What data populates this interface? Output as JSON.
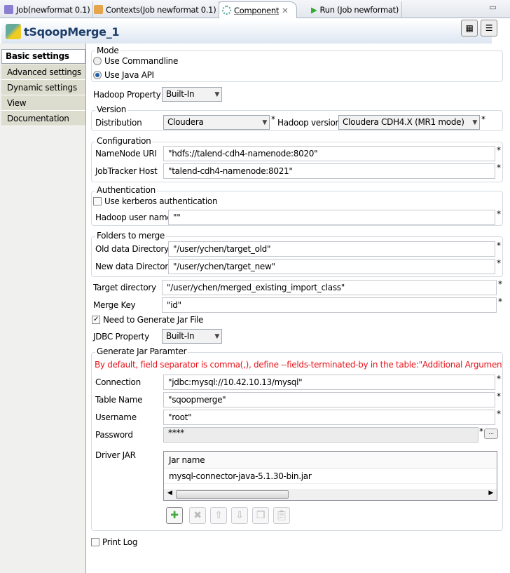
{
  "tabs": [
    {
      "label": "Job(newformat 0.1)",
      "icon": "job-icon"
    },
    {
      "label": "Contexts(Job newformat 0.1)",
      "icon": "contexts-icon"
    },
    {
      "label": "Component",
      "icon": "component-icon",
      "active": true
    },
    {
      "label": "Run (Job newformat)",
      "icon": "run-icon"
    }
  ],
  "header": {
    "title": "tSqoopMerge_1"
  },
  "sidebar": {
    "items": [
      {
        "label": "Basic settings",
        "selected": true
      },
      {
        "label": "Advanced settings"
      },
      {
        "label": "Dynamic settings"
      },
      {
        "label": "View"
      },
      {
        "label": "Documentation"
      }
    ]
  },
  "mode": {
    "legend": "Mode",
    "option1": "Use Commandline",
    "option2": "Use Java API",
    "selected": "Use Java API"
  },
  "hadoop_property": {
    "label": "Hadoop Property",
    "value": "Built-In"
  },
  "version": {
    "legend": "Version",
    "distribution_label": "Distribution",
    "distribution": "Cloudera",
    "hadoop_version_label": "Hadoop version",
    "hadoop_version": "Cloudera CDH4.X (MR1 mode)"
  },
  "configuration": {
    "legend": "Configuration",
    "namenode_label": "NameNode URI",
    "namenode": "\"hdfs://talend-cdh4-namenode:8020\"",
    "jobtracker_label": "JobTracker Host",
    "jobtracker": "\"talend-cdh4-namenode:8021\""
  },
  "authentication": {
    "legend": "Authentication",
    "kerberos_label": "Use kerberos authentication",
    "kerberos": false,
    "user_label": "Hadoop user name",
    "user": "\"\""
  },
  "folders": {
    "legend": "Folders to merge",
    "old_label": "Old data Directory",
    "old": "\"/user/ychen/target_old\"",
    "new_label": "New data Directory",
    "new": "\"/user/ychen/target_new\""
  },
  "target": {
    "label": "Target directory",
    "value": "\"/user/ychen/merged_existing_import_class\""
  },
  "merge_key": {
    "label": "Merge Key",
    "value": "\"id\""
  },
  "need_jar": {
    "label": "Need to Generate Jar File",
    "checked": true
  },
  "jdbc_property": {
    "label": "JDBC Property",
    "value": "Built-In"
  },
  "jar": {
    "legend": "Generate Jar Paramter",
    "warning": "By default, field separator is comma(,), define --fields-terminated-by in the table:\"Additional Arguments\" to  s",
    "connection_label": "Connection",
    "connection": "\"jdbc:mysql://10.42.10.13/mysql\"",
    "table_label": "Table Name",
    "table": "\"sqoopmerge\"",
    "username_label": "Username",
    "username": "\"root\"",
    "password_label": "Password",
    "password": "****",
    "password_button": "...",
    "driver_label": "Driver JAR",
    "column": "Jar name",
    "rows": [
      "mysql-connector-java-5.1.30-bin.jar"
    ]
  },
  "print_log": {
    "label": "Print Log",
    "checked": false
  },
  "required_mark": "*",
  "colors": {
    "warning": "#e8141b",
    "title": "#1d3e6a"
  }
}
